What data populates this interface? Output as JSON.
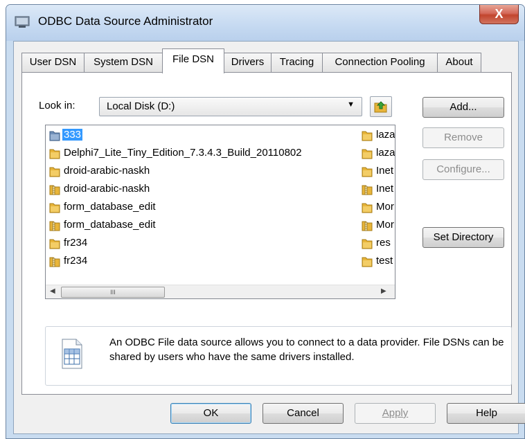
{
  "window": {
    "title": "ODBC Data Source Administrator",
    "close_label": "X"
  },
  "tabs": [
    {
      "label": "User DSN"
    },
    {
      "label": "System DSN"
    },
    {
      "label": "File DSN",
      "active": true
    },
    {
      "label": "Drivers"
    },
    {
      "label": "Tracing"
    },
    {
      "label": "Connection Pooling"
    },
    {
      "label": "About"
    }
  ],
  "look_in": {
    "label": "Look in:",
    "value": "Local Disk (D:)"
  },
  "side_buttons": {
    "add": "Add...",
    "remove": "Remove",
    "configure": "Configure...",
    "set_directory": "Set Directory"
  },
  "files_col1": [
    {
      "name": "333",
      "icon": "folder-blue-icon",
      "selected": true
    },
    {
      "name": "Delphi7_Lite_Tiny_Edition_7.3.4.3_Build_20110802",
      "icon": "folder-icon"
    },
    {
      "name": "droid-arabic-naskh",
      "icon": "folder-icon"
    },
    {
      "name": "droid-arabic-naskh",
      "icon": "folder-zip-icon"
    },
    {
      "name": "form_database_edit",
      "icon": "folder-icon"
    },
    {
      "name": "form_database_edit",
      "icon": "folder-zip-icon"
    },
    {
      "name": "fr234",
      "icon": "folder-icon"
    },
    {
      "name": "fr234",
      "icon": "folder-zip-icon"
    }
  ],
  "files_col2": [
    {
      "name": "laza",
      "icon": "folder-icon"
    },
    {
      "name": "laza",
      "icon": "folder-icon"
    },
    {
      "name": "Inet",
      "icon": "folder-icon"
    },
    {
      "name": "Inet",
      "icon": "folder-zip-icon"
    },
    {
      "name": "Mor",
      "icon": "folder-icon"
    },
    {
      "name": "Mor",
      "icon": "folder-zip-icon"
    },
    {
      "name": "res",
      "icon": "folder-icon"
    },
    {
      "name": "test",
      "icon": "folder-icon"
    }
  ],
  "info": {
    "text": "An ODBC File data source allows you to connect to a data provider.  File DSNs can be shared by users who have the same drivers installed."
  },
  "bottom_buttons": {
    "ok": "OK",
    "cancel": "Cancel",
    "apply": "Apply",
    "help": "Help"
  },
  "scroll_thumb": "III",
  "colors": {
    "selection": "#3399ff",
    "folder": "#e8b53a",
    "window_frame": "#c9dcf0"
  }
}
